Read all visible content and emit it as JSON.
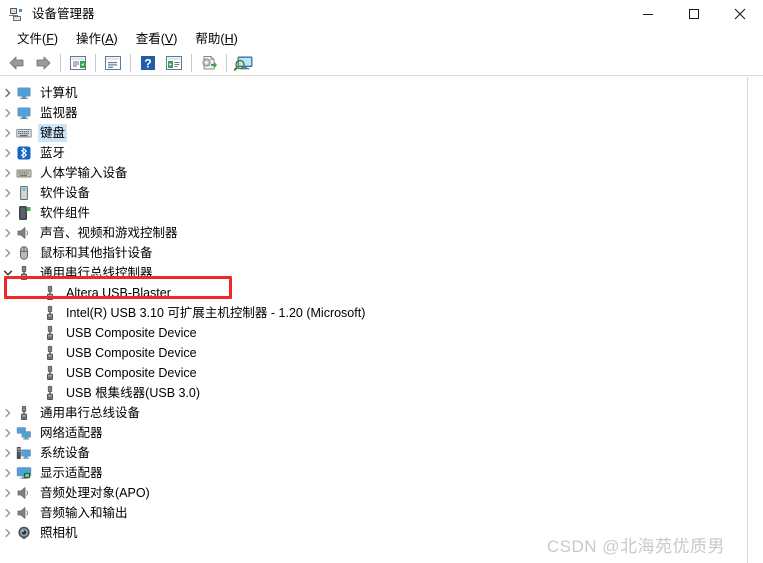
{
  "window": {
    "title": "设备管理器",
    "icon": "device-manager-icon",
    "minimize_label": "最小化",
    "maximize_label": "最大化",
    "close_label": "关闭"
  },
  "menubar": {
    "items": [
      {
        "label": "文件(F)",
        "text": "文件",
        "accel": "F"
      },
      {
        "label": "操作(A)",
        "text": "操作",
        "accel": "A"
      },
      {
        "label": "查看(V)",
        "text": "查看",
        "accel": "V"
      },
      {
        "label": "帮助(H)",
        "text": "帮助",
        "accel": "H"
      }
    ]
  },
  "toolbar": {
    "buttons": [
      {
        "name": "back-button",
        "icon": "back-arrow-icon"
      },
      {
        "name": "forward-button",
        "icon": "forward-arrow-icon"
      },
      {
        "name": "separator-1",
        "icon": "separator"
      },
      {
        "name": "properties-button",
        "icon": "properties-window-icon"
      },
      {
        "name": "separator-2",
        "icon": "separator"
      },
      {
        "name": "show-hidden-button",
        "icon": "list-window-icon"
      },
      {
        "name": "separator-3",
        "icon": "separator"
      },
      {
        "name": "help-button",
        "icon": "help-question-icon"
      },
      {
        "name": "details-button",
        "icon": "details-window-icon"
      },
      {
        "name": "separator-4",
        "icon": "separator"
      },
      {
        "name": "update-driver-button",
        "icon": "update-driver-icon"
      },
      {
        "name": "separator-5",
        "icon": "separator"
      },
      {
        "name": "scan-hardware-button",
        "icon": "scan-monitor-icon"
      }
    ]
  },
  "tree": {
    "rows": [
      {
        "label": "计算机",
        "icon": "monitor-icon",
        "level": 0,
        "expander": "collapsed",
        "selected": false,
        "highlighted": false
      },
      {
        "label": "监视器",
        "icon": "monitor-icon",
        "level": 0,
        "expander": "collapsed",
        "selected": false,
        "highlighted": false
      },
      {
        "label": "键盘",
        "icon": "keyboard-icon",
        "level": 0,
        "expander": "collapsed",
        "selected": true,
        "highlighted": false
      },
      {
        "label": "蓝牙",
        "icon": "bluetooth-icon",
        "level": 0,
        "expander": "collapsed",
        "selected": false,
        "highlighted": false
      },
      {
        "label": "人体学输入设备",
        "icon": "hid-keyboard-icon",
        "level": 0,
        "expander": "collapsed",
        "selected": false,
        "highlighted": false
      },
      {
        "label": "软件设备",
        "icon": "software-device-icon",
        "level": 0,
        "expander": "collapsed",
        "selected": false,
        "highlighted": false
      },
      {
        "label": "软件组件",
        "icon": "software-component-icon",
        "level": 0,
        "expander": "collapsed",
        "selected": false,
        "highlighted": false
      },
      {
        "label": "声音、视频和游戏控制器",
        "icon": "speaker-icon",
        "level": 0,
        "expander": "collapsed",
        "selected": false,
        "highlighted": false
      },
      {
        "label": "鼠标和其他指针设备",
        "icon": "mouse-icon",
        "level": 0,
        "expander": "collapsed",
        "selected": false,
        "highlighted": false
      },
      {
        "label": "通用串行总线控制器",
        "icon": "usb-icon",
        "level": 0,
        "expander": "expanded",
        "selected": false,
        "highlighted": false
      },
      {
        "label": "Altera USB-Blaster",
        "icon": "usb-icon",
        "level": 1,
        "expander": "none",
        "selected": false,
        "highlighted": true
      },
      {
        "label": "Intel(R) USB 3.10 可扩展主机控制器 - 1.20 (Microsoft)",
        "icon": "usb-icon",
        "level": 1,
        "expander": "none",
        "selected": false,
        "highlighted": false
      },
      {
        "label": "USB Composite Device",
        "icon": "usb-icon",
        "level": 1,
        "expander": "none",
        "selected": false,
        "highlighted": false
      },
      {
        "label": "USB Composite Device",
        "icon": "usb-icon",
        "level": 1,
        "expander": "none",
        "selected": false,
        "highlighted": false
      },
      {
        "label": "USB Composite Device",
        "icon": "usb-icon",
        "level": 1,
        "expander": "none",
        "selected": false,
        "highlighted": false
      },
      {
        "label": "USB 根集线器(USB 3.0)",
        "icon": "usb-icon",
        "level": 1,
        "expander": "none",
        "selected": false,
        "highlighted": false
      },
      {
        "label": "通用串行总线设备",
        "icon": "usb-icon",
        "level": 0,
        "expander": "collapsed",
        "selected": false,
        "highlighted": false
      },
      {
        "label": "网络适配器",
        "icon": "network-icon",
        "level": 0,
        "expander": "collapsed",
        "selected": false,
        "highlighted": false
      },
      {
        "label": "系统设备",
        "icon": "system-device-icon",
        "level": 0,
        "expander": "collapsed",
        "selected": false,
        "highlighted": false
      },
      {
        "label": "显示适配器",
        "icon": "display-adapter-icon",
        "level": 0,
        "expander": "collapsed",
        "selected": false,
        "highlighted": false
      },
      {
        "label": "音频处理对象(APO)",
        "icon": "speaker-icon",
        "level": 0,
        "expander": "collapsed",
        "selected": false,
        "highlighted": false
      },
      {
        "label": "音频输入和输出",
        "icon": "speaker-icon",
        "level": 0,
        "expander": "collapsed",
        "selected": false,
        "highlighted": false
      },
      {
        "label": "照相机",
        "icon": "camera-icon",
        "level": 0,
        "expander": "collapsed",
        "selected": false,
        "highlighted": false
      }
    ]
  },
  "annotation": {
    "highlight_color": "#ef2929",
    "target_label": "Altera USB-Blaster"
  },
  "watermark": {
    "text": "CSDN @北海苑优质男",
    "color": "#c9c9c9"
  },
  "colors": {
    "selection": "#cce4f7",
    "accent": "#0078d7",
    "annotation": "#ef2929"
  }
}
